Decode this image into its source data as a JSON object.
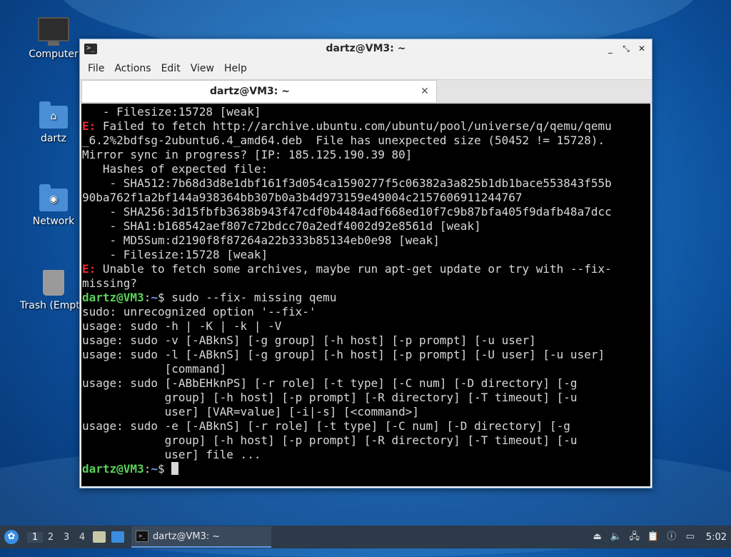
{
  "desktop": {
    "icons": [
      {
        "label": "Computer"
      },
      {
        "label": "dartz"
      },
      {
        "label": "Network"
      },
      {
        "label": "Trash (Empty)"
      }
    ]
  },
  "window": {
    "title": "dartz@VM3: ~",
    "menu": [
      "File",
      "Actions",
      "Edit",
      "View",
      "Help"
    ],
    "tab_label": "dartz@VM3: ~",
    "tab_close": "✕",
    "controls": {
      "minimize": "_",
      "maximize": "⤡",
      "close": "✕"
    }
  },
  "terminal": {
    "prompt_user": "dartz@VM3",
    "prompt_path": "~",
    "lines": [
      {
        "text": "   - Filesize:15728 [weak]"
      },
      {
        "err": "E:",
        "text": " Failed to fetch http://archive.ubuntu.com/ubuntu/pool/universe/q/qemu/qemu"
      },
      {
        "text": "_6.2%2bdfsg-2ubuntu6.4_amd64.deb  File has unexpected size (50452 != 15728)."
      },
      {
        "text": "Mirror sync in progress? [IP: 185.125.190.39 80]"
      },
      {
        "text": "   Hashes of expected file:"
      },
      {
        "text": "    - SHA512:7b68d3d8e1dbf161f3d054ca1590277f5c06382a3a825b1db1bace553843f55b"
      },
      {
        "text": "90ba762f1a2bf144a938364bb307b0a3b4d973159e49004c2157606911244767"
      },
      {
        "text": "    - SHA256:3d15fbfb3638b943f47cdf0b4484adf668ed10f7c9b87bfa405f9dafb48a7dcc"
      },
      {
        "text": "    - SHA1:b168542aef807c72bdcc70a2edf4002d92e8561d [weak]"
      },
      {
        "text": "    - MD5Sum:d2190f8f87264a22b333b85134eb0e98 [weak]"
      },
      {
        "text": "    - Filesize:15728 [weak]"
      },
      {
        "err": "E:",
        "text": " Unable to fetch some archives, maybe run apt-get update or try with --fix-"
      },
      {
        "text": "missing?"
      },
      {
        "prompt": true,
        "text": " sudo --fix- missing qemu"
      },
      {
        "text": "sudo: unrecognized option '--fix-'"
      },
      {
        "text": "usage: sudo -h | -K | -k | -V"
      },
      {
        "text": "usage: sudo -v [-ABknS] [-g group] [-h host] [-p prompt] [-u user]"
      },
      {
        "text": "usage: sudo -l [-ABknS] [-g group] [-h host] [-p prompt] [-U user] [-u user]"
      },
      {
        "text": "            [command]"
      },
      {
        "text": "usage: sudo [-ABbEHknPS] [-r role] [-t type] [-C num] [-D directory] [-g"
      },
      {
        "text": "            group] [-h host] [-p prompt] [-R directory] [-T timeout] [-u"
      },
      {
        "text": "            user] [VAR=value] [-i|-s] [<command>]"
      },
      {
        "text": "usage: sudo -e [-ABknS] [-r role] [-t type] [-C num] [-D directory] [-g"
      },
      {
        "text": "            group] [-h host] [-p prompt] [-R directory] [-T timeout] [-u"
      },
      {
        "text": "            user] file ..."
      },
      {
        "prompt": true,
        "text": " ",
        "cursor": true
      }
    ]
  },
  "taskbar": {
    "workspaces": [
      "1",
      "2",
      "3",
      "4"
    ],
    "active_workspace": "1",
    "task_label": "dartz@VM3: ~",
    "clock": "5:02",
    "tray_icons": [
      "eject-icon",
      "volume-icon",
      "network-icon",
      "clipboard-icon",
      "notification-icon",
      "power-icon"
    ]
  }
}
